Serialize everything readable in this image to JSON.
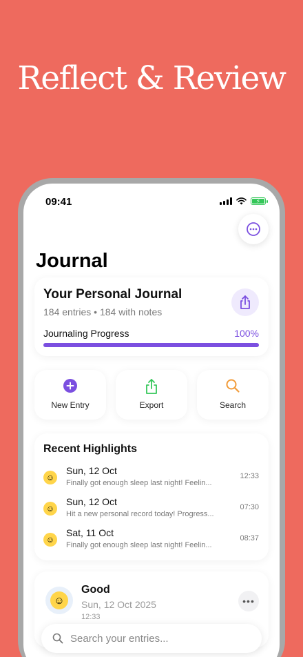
{
  "headline": "Reflect & Review",
  "status_bar": {
    "time": "09:41"
  },
  "page": {
    "title": "Journal"
  },
  "summary": {
    "title": "Your Personal Journal",
    "subtitle": "184 entries • 184 with notes",
    "progress_label": "Journaling Progress",
    "progress_value": "100%",
    "progress_fraction": 1.0
  },
  "actions": [
    {
      "label": "New Entry",
      "icon": "plus-circle-icon",
      "color": "#7B4FE0"
    },
    {
      "label": "Export",
      "icon": "share-icon",
      "color": "#34C759"
    },
    {
      "label": "Search",
      "icon": "search-icon",
      "color": "#F29B38"
    }
  ],
  "highlights": {
    "title": "Recent Highlights",
    "items": [
      {
        "date": "Sun, 12 Oct",
        "snippet": "Finally got enough sleep last night! Feelin...",
        "time": "12:33",
        "icon": "smile-emoji-icon"
      },
      {
        "date": "Sun, 12 Oct",
        "snippet": "Hit a new personal record today! Progress...",
        "time": "07:30",
        "icon": "smile-emoji-icon"
      },
      {
        "date": "Sat, 11 Oct",
        "snippet": "Finally got enough sleep last night! Feelin...",
        "time": "08:37",
        "icon": "smile-emoji-icon"
      }
    ]
  },
  "entry": {
    "mood": "Good",
    "date": "Sun, 12 Oct 2025",
    "time": "12:33",
    "icon": "smile-emoji-icon"
  },
  "search": {
    "placeholder": "Search your entries..."
  },
  "colors": {
    "background": "#EE6A5E",
    "accent": "#7B4FE0",
    "export": "#34C759",
    "search": "#F29B38"
  }
}
